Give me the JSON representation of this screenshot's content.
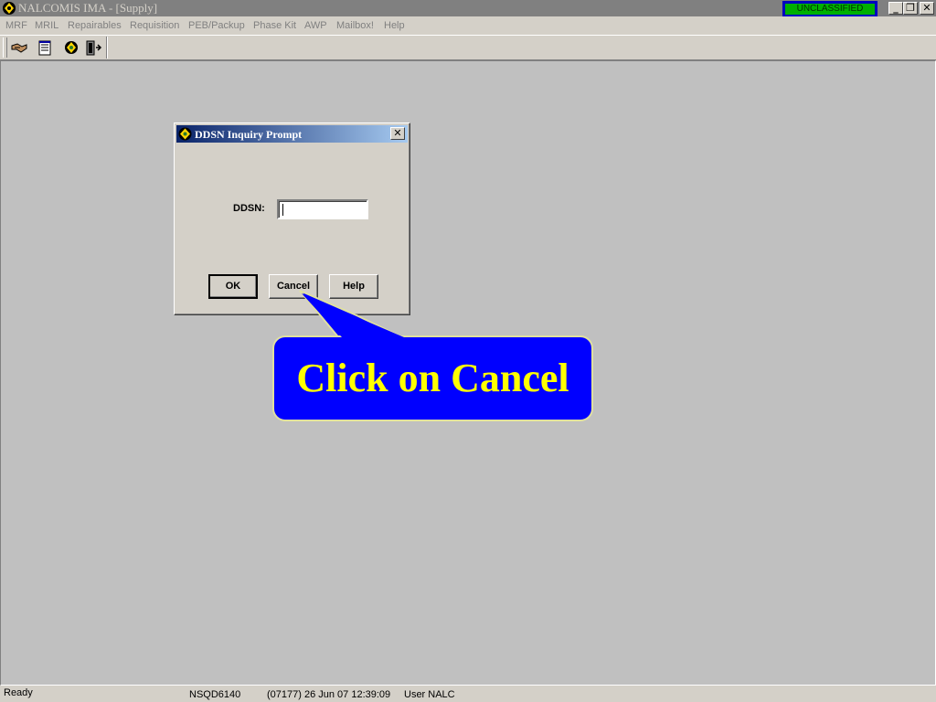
{
  "window": {
    "title": "NALCOMIS IMA - [Supply]",
    "classification": "UNCLASSIFIED",
    "minimize_icon": "minimize-icon",
    "restore_icon": "restore-icon",
    "close_icon": "close-icon"
  },
  "menu": {
    "items": [
      "MRF",
      "MRIL",
      "Repairables",
      "Requisition",
      "PEB/Packup",
      "Phase Kit",
      "AWP",
      "Mailbox!",
      "Help"
    ]
  },
  "toolbar": {
    "icons": [
      "handshake-icon",
      "notepad-icon",
      "globe-icon",
      "exit-door-icon"
    ]
  },
  "dialog": {
    "title": "DDSN Inquiry Prompt",
    "field_label": "DDSN:",
    "field_value": "",
    "ok_label": "OK",
    "cancel_label": "Cancel",
    "help_label": "Help"
  },
  "callout": {
    "text": "Click on Cancel"
  },
  "status": {
    "state": "Ready",
    "server": "NSQD6140",
    "session": "(07177)  26 Jun 07  12:39:09",
    "user": "User NALC"
  },
  "colors": {
    "classification_bg": "#00b000",
    "classification_border": "#0000c0",
    "callout_bg": "#0000ff",
    "callout_text": "#ffff00",
    "dialog_title_start": "#0a246a"
  }
}
